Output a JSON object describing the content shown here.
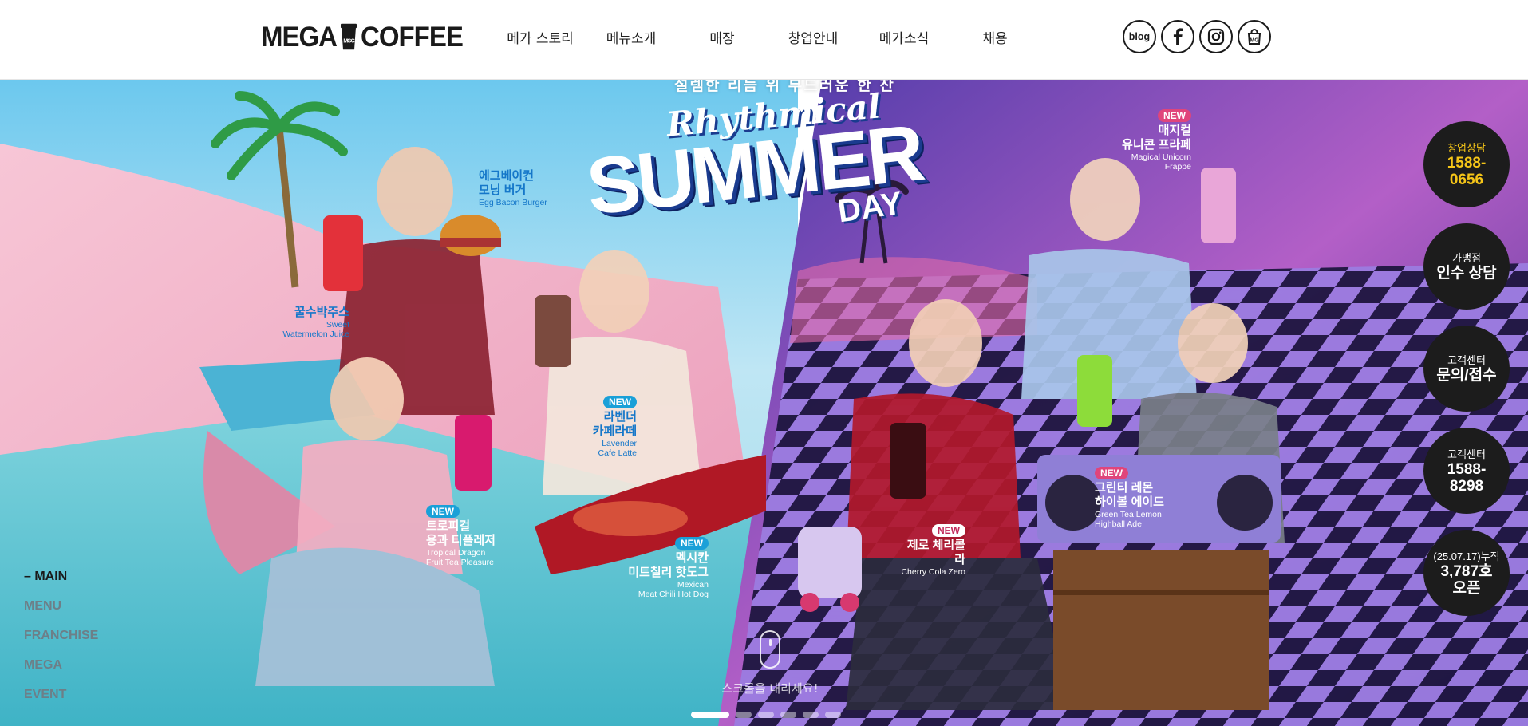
{
  "brand": {
    "logo_left": "MEGA",
    "logo_right": "COFFEE",
    "logo_mark": "MGC"
  },
  "nav": {
    "items": [
      {
        "label": "메가 스토리"
      },
      {
        "label": "메뉴소개"
      },
      {
        "label": "매장"
      },
      {
        "label": "창업안내"
      },
      {
        "label": "메가소식"
      },
      {
        "label": "채용"
      }
    ]
  },
  "social": {
    "blog_label": "blog",
    "facebook_icon": "facebook-icon",
    "instagram_icon": "instagram-icon",
    "store_icon": "shopping-bag-icon"
  },
  "hero": {
    "headline_sub": "설렘한 리듬 위 부드러운 한 잔",
    "headline_rhythm": "Rhythmical",
    "headline_summer": "SUMMER",
    "headline_day": "DAY",
    "products": [
      {
        "ko1": "에그베이컨",
        "ko2": "모닝 버거",
        "en1": "Egg Bacon Burger",
        "en2": "",
        "new": false
      },
      {
        "ko1": "꿀수박주스",
        "ko2": "",
        "en1": "Sweet",
        "en2": "Watermelon Juice",
        "new": false
      },
      {
        "ko1": "라벤더",
        "ko2": "카페라떼",
        "en1": "Lavender",
        "en2": "Cafe Latte",
        "new": true
      },
      {
        "ko1": "트로피컬",
        "ko2": "용과 티플레저",
        "en1": "Tropical Dragon",
        "en2": "Fruit Tea Pleasure",
        "new": true
      },
      {
        "ko1": "멕시칸",
        "ko2": "미트칠리 핫도그",
        "en1": "Mexican",
        "en2": "Meat Chili Hot Dog",
        "new": true
      },
      {
        "ko1": "매지컬",
        "ko2": "유니콘 프라페",
        "en1": "Magical Unicorn",
        "en2": "Frappe",
        "new": true
      },
      {
        "ko1": "그린티 레몬",
        "ko2": "하이볼 에이드",
        "en1": "Green Tea Lemon",
        "en2": "Highball Ade",
        "new": true
      },
      {
        "ko1": "제로 체리콜라",
        "ko2": "",
        "en1": "Cherry Cola Zero",
        "en2": "",
        "new": true
      }
    ],
    "new_badge": "NEW",
    "scroll_hint": "스크롤을 내리세요!",
    "pager": {
      "count": 6,
      "active_index": 0
    }
  },
  "side_nav": {
    "items": [
      {
        "label": "MAIN",
        "active": true,
        "prefix": "– "
      },
      {
        "label": "MENU",
        "active": false
      },
      {
        "label": "FRANCHISE",
        "active": false
      },
      {
        "label": "MEGA",
        "active": false
      },
      {
        "label": "EVENT",
        "active": false
      }
    ]
  },
  "floating": {
    "franchise_call": {
      "small": "창업상담",
      "big1": "1588-",
      "big2": "0656"
    },
    "acquisition": {
      "small": "가맹점",
      "big": "인수 상담"
    },
    "inquiry": {
      "small": "고객센터",
      "big": "문의/접수"
    },
    "cs_call": {
      "small": "고객센터",
      "big1": "1588-",
      "big2": "8298"
    },
    "stores": {
      "small": "(25.07.17)누적",
      "big1": "3,787호",
      "big2": "오픈"
    }
  },
  "colors": {
    "new_blue": "#1aa0d8",
    "new_pink": "#e0457b",
    "label_blue": "#1577c9",
    "gold": "#f5c518"
  }
}
